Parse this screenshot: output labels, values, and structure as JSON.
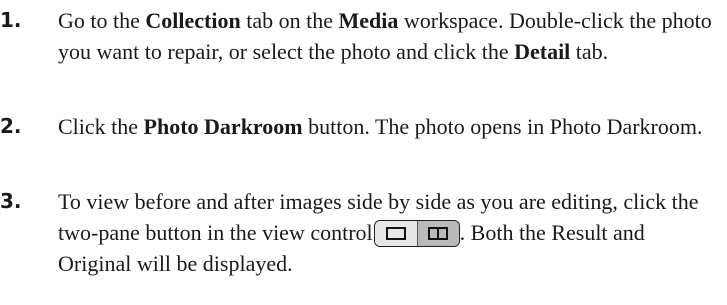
{
  "steps": [
    {
      "number": "1.",
      "parts": [
        "Go to the ",
        "Collection",
        " tab on the ",
        "Media",
        " workspace. Double-click the photo you want to repair, or select the photo and click the ",
        "Detail",
        " tab."
      ]
    },
    {
      "number": "2.",
      "parts": [
        "Click the ",
        "Photo Darkroom",
        " button. The photo opens in Photo Darkroom."
      ]
    },
    {
      "number": "3.",
      "parts": [
        "To view before and after images side by side as you are editing, click the two-pane button in the view control",
        ". Both the Result and Original will be displayed."
      ]
    }
  ],
  "icons": {
    "single_pane": "single-pane-icon",
    "two_pane": "two-pane-icon"
  }
}
